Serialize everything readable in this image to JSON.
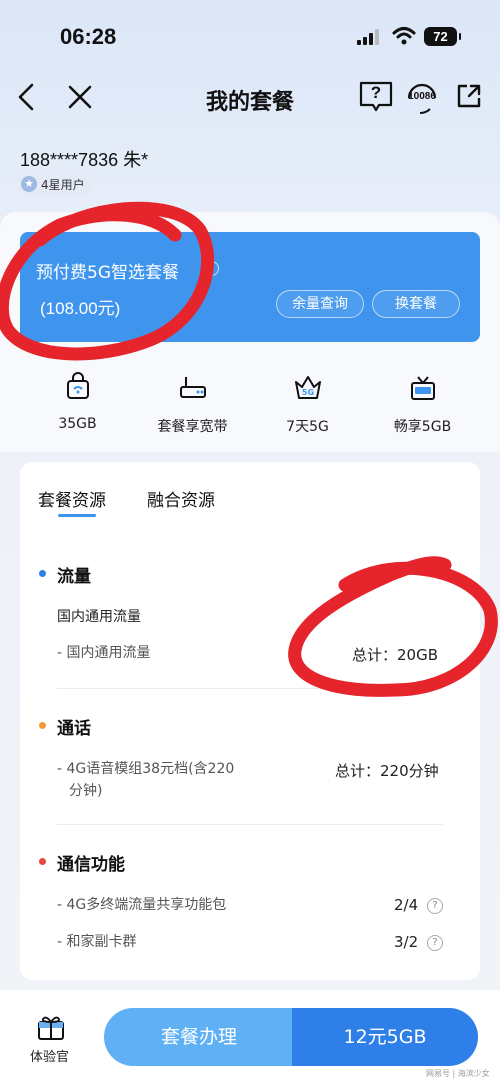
{
  "status": {
    "time": "06:28",
    "battery": "72"
  },
  "header": {
    "title": "我的套餐",
    "hotline": "10086",
    "help_mark": "?"
  },
  "user": {
    "phone": "188****7836 朱*",
    "level": "4星用户"
  },
  "plan": {
    "name": "预付费5G智选套餐",
    "price": "(108.00元)",
    "balance_button": "余量查询",
    "change_button": "换套餐"
  },
  "features": [
    {
      "label": "35GB",
      "icon": "data-package-icon"
    },
    {
      "label": "套餐享宽带",
      "icon": "router-icon"
    },
    {
      "label": "7天5G",
      "icon": "5g-crown-icon"
    },
    {
      "label": "畅享5GB",
      "icon": "gift-month-icon"
    }
  ],
  "tabs": {
    "active": "套餐资源",
    "other": "融合资源"
  },
  "data_section": {
    "title": "流量",
    "sub_title": "国内通用流量",
    "row_label": "- 国内通用流量",
    "row_value": "总计：20GB"
  },
  "call_section": {
    "title": "通话",
    "row_label_1": "- 4G语音模组38元档(含220",
    "row_label_2": "分钟)",
    "row_value": "总计：220分钟"
  },
  "function_section": {
    "title": "通信功能",
    "rows": [
      {
        "label": "- 4G多终端流量共享功能包",
        "value": "2/4"
      },
      {
        "label": "- 和家副卡群",
        "value": "3/2"
      }
    ]
  },
  "bottom": {
    "experience_label": "体验官",
    "cta_label": "套餐办理",
    "promo_label": "12元5GB",
    "watermark": "网易号 | 海滨少女"
  },
  "colors": {
    "accent": "#3f95ed",
    "annotation": "#e5242b"
  }
}
